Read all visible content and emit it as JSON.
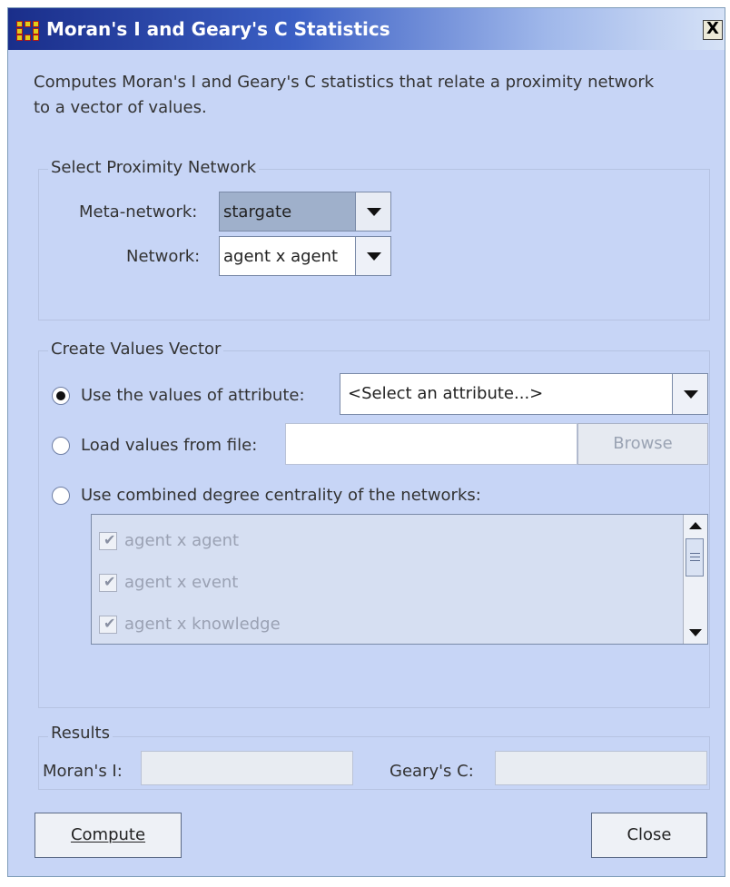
{
  "window": {
    "title": "Moran's I and Geary's C Statistics",
    "close_glyph": "X"
  },
  "description": "Computes Moran's I and Geary's C statistics that relate a proximity network to a vector of values.",
  "proximity": {
    "legend": "Select Proximity Network",
    "metanetwork_label": "Meta-network:",
    "metanetwork_value": "stargate",
    "network_label": "Network:",
    "network_value": "agent x agent"
  },
  "values_vector": {
    "legend": "Create Values Vector",
    "selected_option": "attribute",
    "attribute_label": "Use the values of attribute:",
    "attribute_value": "<Select an attribute...>",
    "file_label": "Load values from file:",
    "file_value": "",
    "browse_label": "Browse",
    "centrality_label": "Use combined degree centrality of the networks:",
    "networks": [
      {
        "label": "agent x agent",
        "checked": true,
        "enabled": false
      },
      {
        "label": "agent x event",
        "checked": true,
        "enabled": false
      },
      {
        "label": "agent x knowledge",
        "checked": true,
        "enabled": false
      }
    ]
  },
  "results": {
    "legend": "Results",
    "morans_label": "Moran's I:",
    "morans_value": "",
    "gearys_label": "Geary's C:",
    "gearys_value": ""
  },
  "buttons": {
    "compute_label": "Compute",
    "close_label": "Close"
  },
  "colors": {
    "dialog_bg": "#c7d5f6",
    "titlebar_start": "#1a2e8a",
    "titlebar_end": "#d6e2f7",
    "metanetwork_combo_bg": "#9fb0cb"
  }
}
